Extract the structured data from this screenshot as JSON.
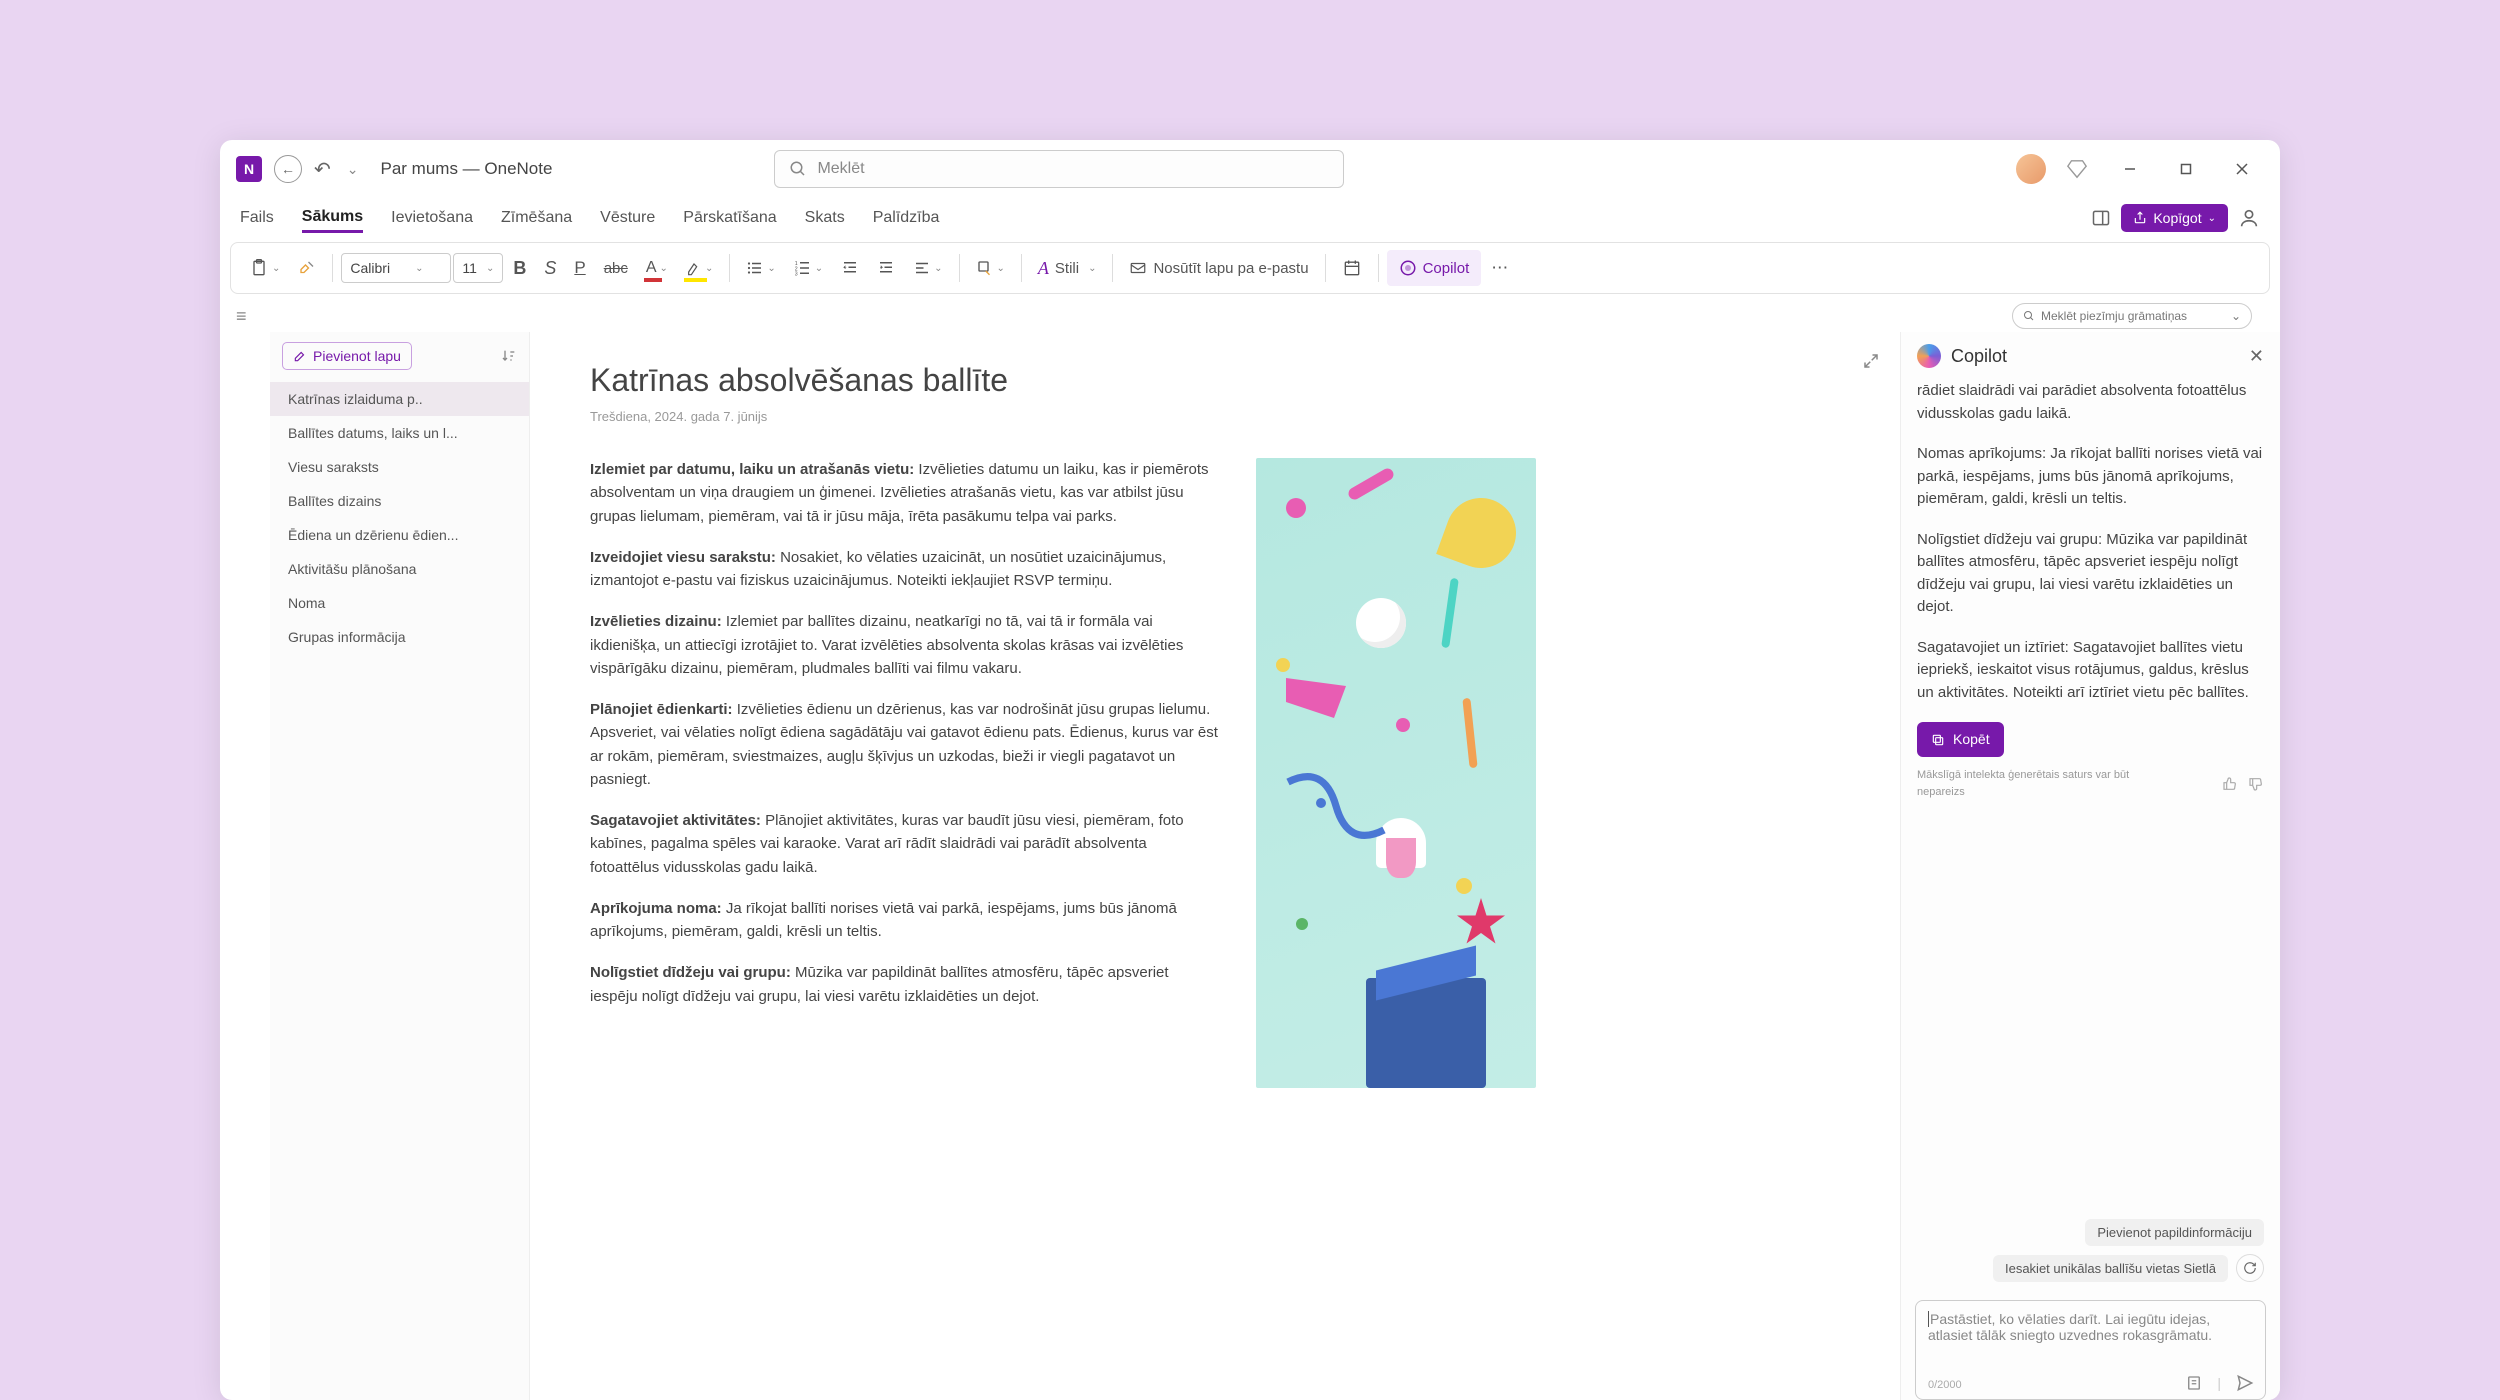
{
  "titlebar": {
    "title": "Par mums — OneNote",
    "search_placeholder": "Meklēt"
  },
  "tabs": {
    "file": "Fails",
    "home": "Sākums",
    "insert": "Ievietošana",
    "draw": "Zīmēšana",
    "history": "Vēsture",
    "review": "Pārskatīšana",
    "view": "Skats",
    "help": "Palīdzība",
    "share": "Kopīgot"
  },
  "toolbar": {
    "font": "Calibri",
    "size": "11",
    "styles": "Stili",
    "email": "Nosūtīt lapu pa e-pastu",
    "copilot": "Copilot"
  },
  "subbar": {
    "search_notebooks": "Meklēt piezīmju grāmatiņas"
  },
  "pagelist": {
    "add_page": "Pievienot lapu",
    "items": [
      "Katrīnas izlaiduma p..",
      "Ballītes datums, laiks un l...",
      "Viesu saraksts",
      "Ballītes dizains",
      "Ēdiena un dzērienu ēdien...",
      "Aktivitāšu plānošana",
      "Noma",
      "Grupas informācija"
    ]
  },
  "page": {
    "title": "Katrīnas absolvēšanas ballīte",
    "date": "Trešdiena, 2024. gada 7. jūnijs",
    "p1b": "Izlemiet par datumu, laiku un atrašanās vietu:",
    "p1": " Izvēlieties datumu un laiku, kas ir piemērots absolventam un viņa draugiem un ģimenei. Izvēlieties atrašanās vietu, kas var atbilst jūsu grupas lielumam, piemēram, vai tā ir jūsu māja, īrēta pasākumu telpa vai parks.",
    "p2b": "Izveidojiet viesu sarakstu:",
    "p2": " Nosakiet, ko vēlaties uzaicināt, un nosūtiet uzaicinājumus, izmantojot e-pastu vai fiziskus uzaicinājumus. Noteikti iekļaujiet RSVP termiņu.",
    "p3b": "Izvēlieties dizainu:",
    "p3": " Izlemiet par ballītes dizainu, neatkarīgi no tā, vai tā ir formāla vai ikdienišķa, un attiecīgi izrotājiet to. Varat izvēlēties absolventa skolas krāsas vai izvēlēties vispārīgāku dizainu, piemēram, pludmales ballīti vai filmu vakaru.",
    "p4b": "Plānojiet ēdienkarti:",
    "p4": " Izvēlieties ēdienu un dzērienus, kas var nodrošināt jūsu grupas lielumu. Apsveriet, vai vēlaties nolīgt ēdiena sagādātāju vai gatavot ēdienu pats. Ēdienus, kurus var ēst ar rokām, piemēram, sviestmaizes, augļu šķīvjus un uzkodas, bieži ir viegli pagatavot un pasniegt.",
    "p5b": "Sagatavojiet aktivitātes:",
    "p5": " Plānojiet aktivitātes, kuras var baudīt jūsu viesi, piemēram, foto kabīnes, pagalma spēles vai karaoke. Varat arī rādīt slaidrādi vai parādīt absolventa fotoattēlus vidusskolas gadu laikā.",
    "p6b": "Aprīkojuma noma:",
    "p6": " Ja rīkojat ballīti norises vietā vai parkā, iespējams, jums būs jānomā aprīkojums, piemēram, galdi, krēsli un teltis.",
    "p7b": "Nolīgstiet dīdžeju vai grupu:",
    "p7": " Mūzika var papildināt ballītes atmosfēru, tāpēc apsveriet iespēju nolīgt dīdžeju vai grupu, lai viesi varētu izklaidēties un dejot."
  },
  "copilot": {
    "title": "Copilot",
    "m0": "rādiet slaidrādi vai parādiet absolventa fotoattēlus vidusskolas gadu laikā.",
    "m1": "Nomas aprīkojums: Ja rīkojat ballīti norises vietā vai parkā, iespējams, jums būs jānomā aprīkojums, piemēram, galdi, krēsli un teltis.",
    "m2": "Nolīgstiet dīdžeju vai grupu: Mūzika var papildināt ballītes atmosfēru, tāpēc apsveriet iespēju nolīgt dīdžeju vai grupu, lai viesi varētu izklaidēties un dejot.",
    "m3": "Sagatavojiet un iztīriet: Sagatavojiet ballītes vietu iepriekš, ieskaitot visus rotājumus, galdus, krēslus un aktivitātes. Noteikti arī iztīriet vietu pēc ballītes.",
    "copy": "Kopēt",
    "disclaimer": "Mākslīgā intelekta ģenerētais saturs var būt nepareizs",
    "chip1": "Pievienot papildinformāciju",
    "chip2": "Iesakiet unikālas ballīšu vietas Sietlā",
    "placeholder": "Pastāstiet, ko vēlaties darīt. Lai iegūtu idejas, atlasiet tālāk sniegto uzvednes rokasgrāmatu.",
    "counter": "0/2000"
  }
}
